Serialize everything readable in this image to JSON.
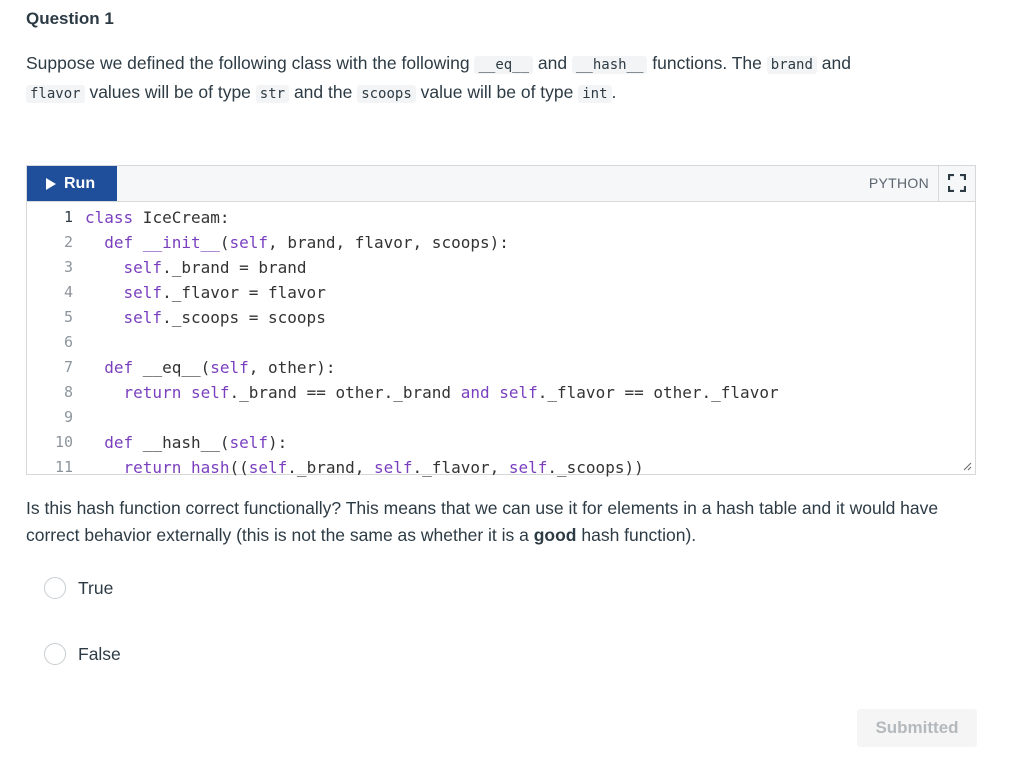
{
  "question": {
    "title": "Question 1",
    "prompt_parts": {
      "p1": "Suppose we defined the following class with the following ",
      "eq": "__eq__",
      "p2": " and ",
      "hash": "__hash__",
      "p3": " functions. The ",
      "brand": "brand",
      "p4": " and",
      "flavor": "flavor",
      "p5": " values will be of type ",
      "str": "str",
      "p6": " and the ",
      "scoops": "scoops",
      "p7": " value will be of type ",
      "int": "int",
      "p8": "."
    },
    "body_parts": {
      "b1": "Is this hash function correct functionally? This means that we can use it for elements in a hash table and it would have correct behavior externally (this is not the same as whether it is a ",
      "bold": "good",
      "b2": " hash function)."
    }
  },
  "editor": {
    "run_label": "Run",
    "language": "PYTHON",
    "lines": [
      {
        "n": "1",
        "segs": [
          {
            "t": "class",
            "k": true
          },
          {
            "t": " IceCream:"
          }
        ]
      },
      {
        "n": "2",
        "segs": [
          {
            "t": "  "
          },
          {
            "t": "def",
            "k": true
          },
          {
            "t": " "
          },
          {
            "t": "__init__",
            "k": true
          },
          {
            "t": "("
          },
          {
            "t": "self",
            "k": true
          },
          {
            "t": ", brand, flavor, scoops):"
          }
        ]
      },
      {
        "n": "3",
        "segs": [
          {
            "t": "    "
          },
          {
            "t": "self",
            "k": true
          },
          {
            "t": "._brand = brand"
          }
        ]
      },
      {
        "n": "4",
        "segs": [
          {
            "t": "    "
          },
          {
            "t": "self",
            "k": true
          },
          {
            "t": "._flavor = flavor"
          }
        ]
      },
      {
        "n": "5",
        "segs": [
          {
            "t": "    "
          },
          {
            "t": "self",
            "k": true
          },
          {
            "t": "._scoops = scoops"
          }
        ]
      },
      {
        "n": "6",
        "segs": []
      },
      {
        "n": "7",
        "segs": [
          {
            "t": "  "
          },
          {
            "t": "def",
            "k": true
          },
          {
            "t": " __eq__("
          },
          {
            "t": "self",
            "k": true
          },
          {
            "t": ", other):"
          }
        ]
      },
      {
        "n": "8",
        "segs": [
          {
            "t": "    "
          },
          {
            "t": "return",
            "k": true
          },
          {
            "t": " "
          },
          {
            "t": "self",
            "k": true
          },
          {
            "t": "._brand == other._brand "
          },
          {
            "t": "and",
            "k": true
          },
          {
            "t": " "
          },
          {
            "t": "self",
            "k": true
          },
          {
            "t": "._flavor == other._flavor"
          }
        ]
      },
      {
        "n": "9",
        "segs": []
      },
      {
        "n": "10",
        "segs": [
          {
            "t": "  "
          },
          {
            "t": "def",
            "k": true
          },
          {
            "t": " __hash__("
          },
          {
            "t": "self",
            "k": true
          },
          {
            "t": "):"
          }
        ]
      },
      {
        "n": "11",
        "segs": [
          {
            "t": "    "
          },
          {
            "t": "return",
            "k": true
          },
          {
            "t": " "
          },
          {
            "t": "hash",
            "k": true
          },
          {
            "t": "(("
          },
          {
            "t": "self",
            "k": true
          },
          {
            "t": "._brand, "
          },
          {
            "t": "self",
            "k": true
          },
          {
            "t": "._flavor, "
          },
          {
            "t": "self",
            "k": true
          },
          {
            "t": "._scoops))"
          }
        ]
      }
    ]
  },
  "options": [
    {
      "label": "True"
    },
    {
      "label": "False"
    }
  ],
  "submit_label": "Submitted",
  "colors": {
    "run_button": "#1f4e9a",
    "keyword": "#7a3fbf",
    "text": "#2d3b45"
  }
}
